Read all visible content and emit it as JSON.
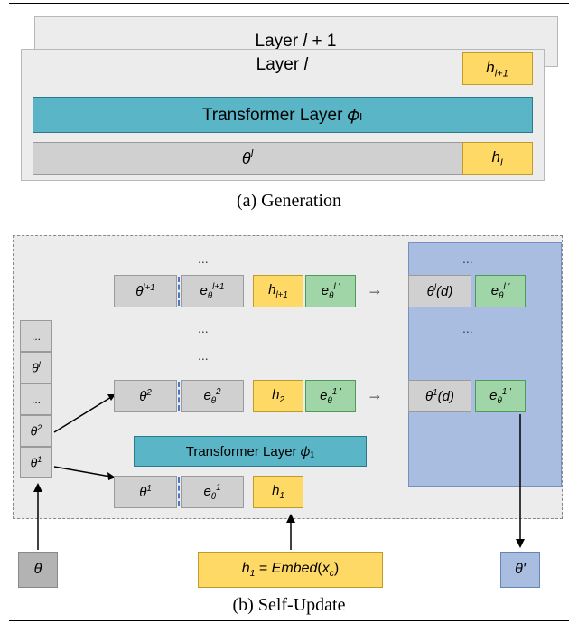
{
  "panel_a": {
    "caption": "(a) Generation",
    "layer_back_label": "Layer 𝑙 + 1",
    "layer_front_label": "Layer 𝑙",
    "h_top": "h_{l+1}",
    "transformer_label": "Transformer Layer 𝜙ₗ",
    "theta_l": "θ^l",
    "h_bottom": "h_l"
  },
  "panel_b": {
    "caption": "(b) Self-Update",
    "left_stack": [
      "...",
      "θ^l",
      "...",
      "θ^2",
      "θ^1"
    ],
    "row_top": {
      "theta": "θ^{l+1}",
      "e": "e_θ^{l+1}",
      "h": "h_{l+1}",
      "g": "e_θ^{l'}",
      "out_theta": "θ^l(d)",
      "out_e": "e_θ^{l'}"
    },
    "row_mid": {
      "theta": "θ^2",
      "e": "e_θ^2",
      "h": "h_2",
      "g": "e_θ^{1'}",
      "out_theta": "θ^1(d)",
      "out_e": "e_θ^{1'}"
    },
    "transformer_label": "Transformer Layer 𝜙₁",
    "row_bottom": {
      "theta": "θ^1",
      "e": "e_θ^1",
      "h": "h_1"
    },
    "dots": "...",
    "ext_theta": "θ",
    "ext_h1": "h₁ = Embed(x_c)",
    "ext_thetap": "θ'",
    "arrows": "→"
  },
  "chart_data": {
    "type": "table",
    "title": "Architecture diagram: Generation and Self-Update",
    "panels": [
      {
        "name": "Generation",
        "layers": [
          "Layer l",
          "Layer l+1"
        ],
        "inputs": [
          "θ^l",
          "h_l"
        ],
        "module": "Transformer Layer φ_l",
        "output": "h_{l+1}"
      },
      {
        "name": "Self-Update",
        "input_stack": [
          "θ^1",
          "θ^2",
          "...",
          "θ^l",
          "..."
        ],
        "steps": [
          {
            "in": [
              "θ^1",
              "e_θ^1",
              "h_1"
            ],
            "module": "Transformer Layer φ_1"
          },
          {
            "in": [
              "θ^2",
              "e_θ^2",
              "h_2",
              "e_θ^{1'}"
            ],
            "out": [
              "θ^1(d)",
              "e_θ^{1'}"
            ]
          },
          {
            "in": [
              "θ^{l+1}",
              "e_θ^{l+1}",
              "h_{l+1}",
              "e_θ^{l'}"
            ],
            "out": [
              "θ^l(d)",
              "e_θ^{l'}"
            ]
          }
        ],
        "external_inputs": {
          "θ": "θ",
          "h_1": "h_1 = Embed(x_c)"
        },
        "external_output": "θ'"
      }
    ]
  }
}
